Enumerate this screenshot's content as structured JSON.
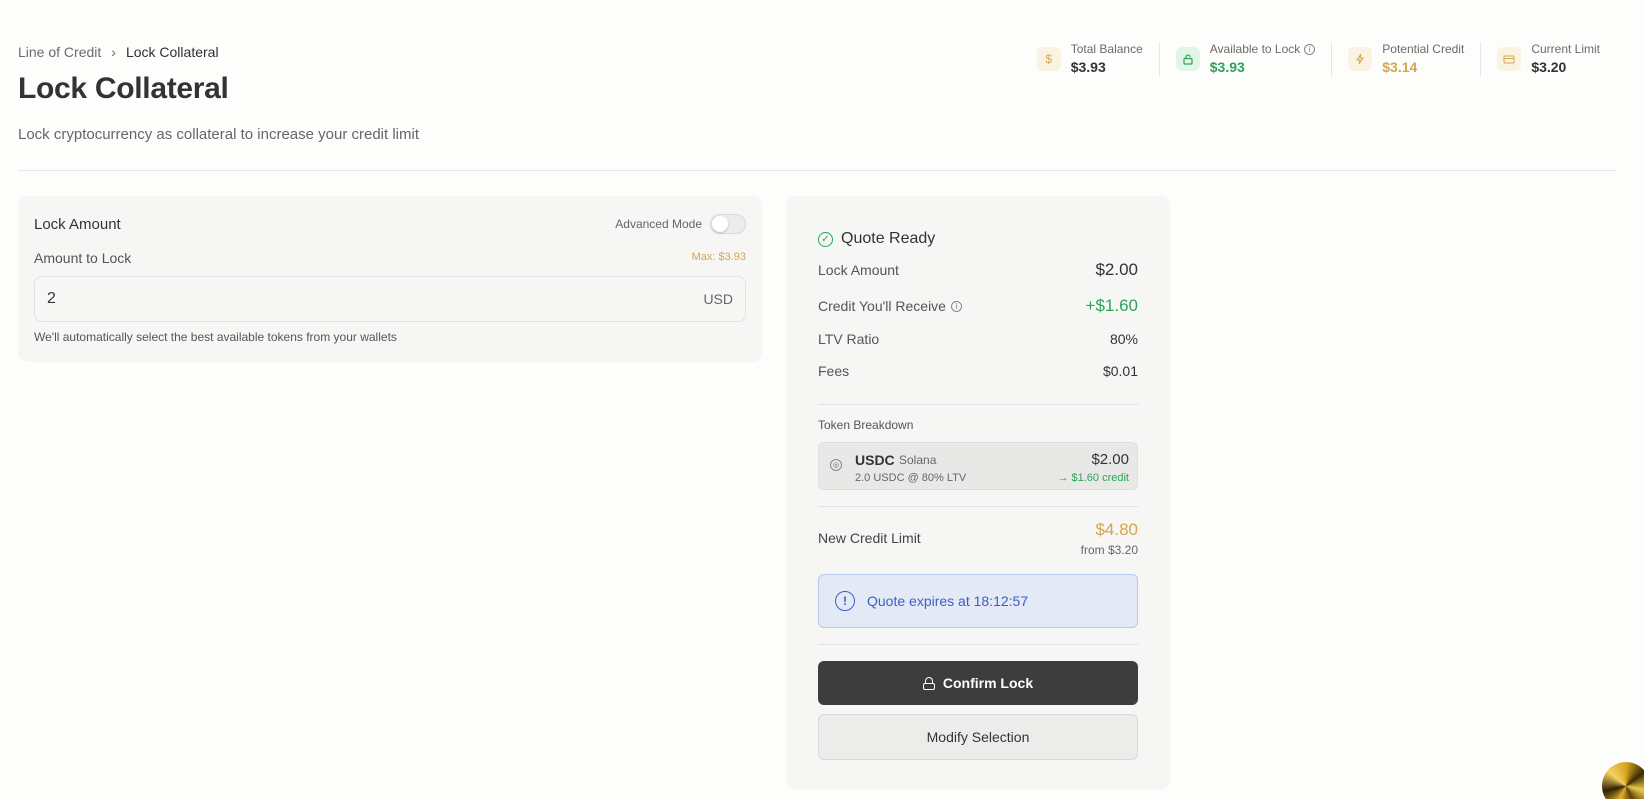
{
  "breadcrumb": {
    "parent": "Line of Credit",
    "separator": "›",
    "current": "Lock Collateral"
  },
  "header": {
    "title": "Lock Collateral",
    "subtitle": "Lock cryptocurrency as collateral to increase your credit limit"
  },
  "stats": [
    {
      "label": "Total Balance",
      "value": "$3.93",
      "icon": "dollar-icon",
      "icon_glyph": "$",
      "icon_bg": "#fbf3e2",
      "icon_color": "#d4a64d",
      "value_color": "#333333"
    },
    {
      "label": "Available to Lock",
      "value": "$3.93",
      "icon": "lock-icon",
      "icon_glyph": "🔓",
      "icon_bg": "#e3f4e8",
      "icon_color": "#2aa457",
      "value_color": "#2aa457"
    },
    {
      "label": "Potential Credit",
      "value": "$3.14",
      "icon": "lightning-icon",
      "icon_glyph": "⚡",
      "icon_bg": "#fbf3e2",
      "icon_color": "#d4a64d",
      "value_color": "#d4a64d"
    },
    {
      "label": "Current Limit",
      "value": "$3.20",
      "icon": "card-icon",
      "icon_glyph": "▭",
      "icon_bg": "#fbf3e2",
      "icon_color": "#d4a64d",
      "value_color": "#333333"
    }
  ],
  "lock_card": {
    "title": "Lock Amount",
    "advanced_mode_label": "Advanced Mode",
    "amount_label": "Amount to Lock",
    "max_label": "Max: $3.93",
    "amount_value": "2",
    "unit": "USD",
    "hint": "We'll automatically select the best available tokens from your wallets"
  },
  "quote": {
    "title": "Quote Ready",
    "lock_amount_label": "Lock Amount",
    "lock_amount_value": "$2.00",
    "credit_label": "Credit You'll Receive",
    "credit_value": "+$1.60",
    "ltv_label": "LTV Ratio",
    "ltv_value": "80%",
    "fees_label": "Fees",
    "fees_value": "$0.01",
    "token_breakdown_title": "Token Breakdown",
    "token": {
      "symbol": "USDC",
      "chain": "Solana",
      "detail": "2.0 USDC @ 80% LTV",
      "usd": "$2.00",
      "credit": "→ $1.60 credit"
    },
    "new_limit_label": "New Credit Limit",
    "new_limit_value": "$4.80",
    "new_limit_from": "from $3.20",
    "expires_text": "Quote expires at 18:12:57",
    "confirm_label": "Confirm Lock",
    "modify_label": "Modify Selection"
  },
  "colors": {
    "accent_gold": "#d4a64d",
    "success_green": "#2aa457",
    "info_blue": "#3d5fc4",
    "button_dark": "#3d3d3d"
  }
}
